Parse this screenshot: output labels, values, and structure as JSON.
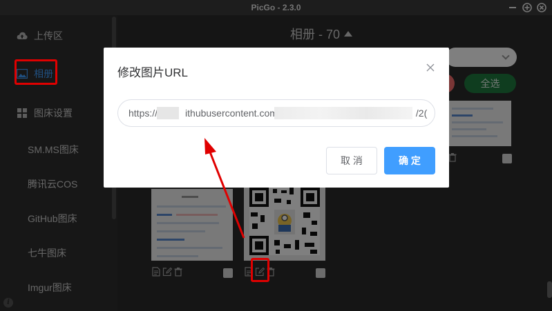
{
  "window": {
    "title": "PicGo - 2.3.0"
  },
  "sidebar": {
    "items": [
      {
        "label": "上传区",
        "icon": "cloud-upload-icon"
      },
      {
        "label": "相册",
        "icon": "image-icon",
        "active": true
      },
      {
        "label": "图床设置",
        "icon": "grid-icon"
      },
      {
        "label": "SM.MS图床"
      },
      {
        "label": "腾讯云COS"
      },
      {
        "label": "GitHub图床"
      },
      {
        "label": "七牛图床"
      },
      {
        "label": "Imgur图床"
      }
    ]
  },
  "main": {
    "album_title": "相册 - 70",
    "select_all_label": "全选"
  },
  "dialog": {
    "title": "修改图片URL",
    "url_prefix": "https://",
    "url_middle": "ithubusercontent.com",
    "url_suffix": "/2(",
    "cancel_label": "取 消",
    "confirm_label": "确 定"
  },
  "colors": {
    "accent": "#409eff",
    "highlight": "#e00000",
    "select_all": "#1f7a3e",
    "danger": "#f56c6c"
  }
}
